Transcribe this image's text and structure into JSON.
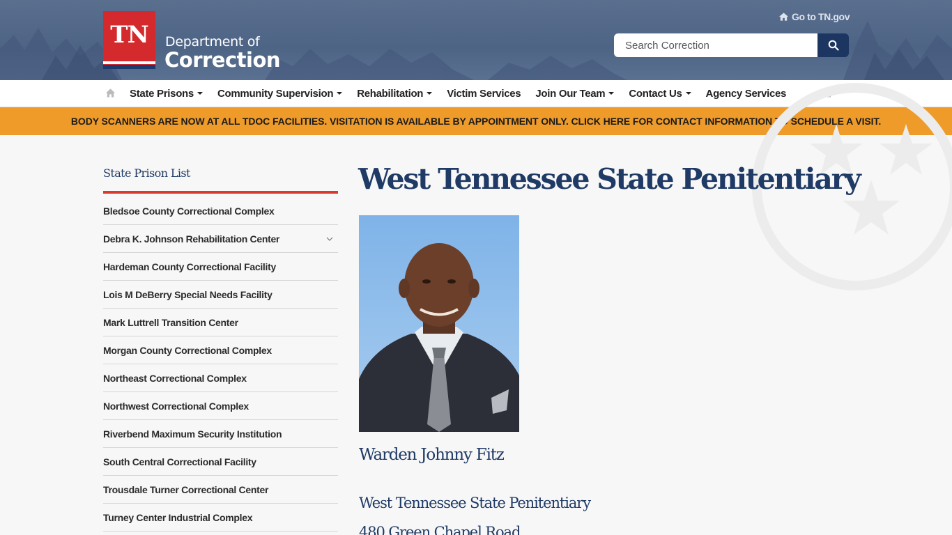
{
  "header": {
    "logo_tn": "TN",
    "logo_dept": "Department of",
    "logo_name": "Correction",
    "goto_link": "Go to TN.gov",
    "search_placeholder": "Search Correction",
    "brand_red": "#d42a2e",
    "brand_navy": "#1d3661"
  },
  "nav": {
    "items": [
      {
        "label": "State Prisons",
        "dropdown": true
      },
      {
        "label": "Community Supervision",
        "dropdown": true
      },
      {
        "label": "Rehabilitation",
        "dropdown": true
      },
      {
        "label": "Victim Services",
        "dropdown": false
      },
      {
        "label": "Join Our Team",
        "dropdown": true
      },
      {
        "label": "Contact Us",
        "dropdown": true
      },
      {
        "label": "Agency Services",
        "dropdown": false
      }
    ],
    "home_icon": "home-icon",
    "print_icon": "print-icon"
  },
  "alert": {
    "text": "BODY SCANNERS ARE NOW AT ALL TDOC FACILITIES. VISITATION IS AVAILABLE BY APPOINTMENT ONLY. CLICK HERE FOR CONTACT INFORMATION TO SCHEDULE A VISIT.",
    "color": "#ee9b2a"
  },
  "sidebar": {
    "title": "State Prison List",
    "items": [
      {
        "label": "Bledsoe County Correctional Complex",
        "expandable": false
      },
      {
        "label": "Debra K. Johnson Rehabilitation Center",
        "expandable": true
      },
      {
        "label": "Hardeman County Correctional Facility",
        "expandable": false
      },
      {
        "label": "Lois M DeBerry Special Needs Facility",
        "expandable": false
      },
      {
        "label": "Mark Luttrell Transition Center",
        "expandable": false
      },
      {
        "label": "Morgan County Correctional Complex",
        "expandable": false
      },
      {
        "label": "Northeast Correctional Complex",
        "expandable": false
      },
      {
        "label": "Northwest Correctional Complex",
        "expandable": false
      },
      {
        "label": "Riverbend Maximum Security Institution",
        "expandable": false
      },
      {
        "label": "South Central Correctional Facility",
        "expandable": false
      },
      {
        "label": "Trousdale Turner Correctional Center",
        "expandable": false
      },
      {
        "label": "Turney Center Industrial Complex",
        "expandable": false
      }
    ]
  },
  "main": {
    "title": "West Tennessee State Penitentiary",
    "warden": "Warden Johnny Fitz",
    "address_name": "West Tennessee State Penitentiary",
    "address_street": "480 Green Chapel Road"
  }
}
